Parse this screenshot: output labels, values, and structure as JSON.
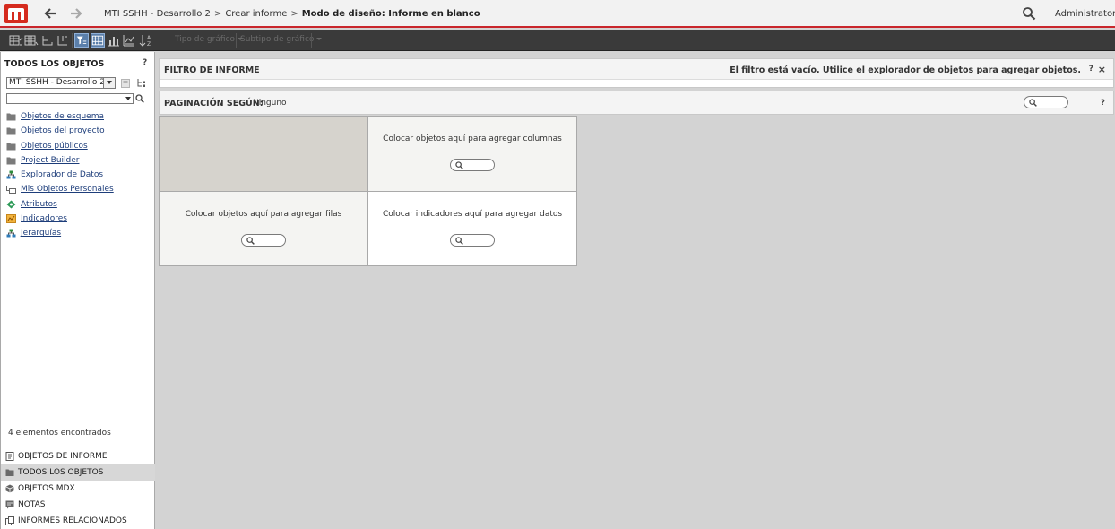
{
  "header": {
    "breadcrumb": [
      {
        "label": "MTI SSHH - Desarrollo 2"
      },
      {
        "label": "Crear informe"
      }
    ],
    "current": "Modo de diseño: Informe en blanco",
    "user": "Administrator"
  },
  "toolbar": {
    "chart_type": "Tipo de gráfico",
    "chart_subtype": "Subtipo de gráfico"
  },
  "left_panel": {
    "title": "TODOS LOS OBJETOS",
    "help": "?",
    "project": "MTI SSHH - Desarrollo 2",
    "tree": [
      {
        "label": "Objetos de esquema",
        "icon": "folder-icon"
      },
      {
        "label": "Objetos del proyecto",
        "icon": "folder-icon"
      },
      {
        "label": "Objetos públicos",
        "icon": "folder-icon"
      },
      {
        "label": "Project Builder",
        "icon": "folder-icon"
      },
      {
        "label": "Explorador de Datos",
        "icon": "hierarchy-icon"
      },
      {
        "label": "Mis Objetos Personales",
        "icon": "personal-objects-icon"
      },
      {
        "label": "Atributos",
        "icon": "attribute-icon"
      },
      {
        "label": "Indicadores",
        "icon": "metrics-icon"
      },
      {
        "label": "Jerarquías",
        "icon": "hierarchy-icon"
      }
    ],
    "found": "4 elementos encontrados",
    "accordion": [
      {
        "label": "OBJETOS DE INFORME",
        "icon": "report-objects-icon"
      },
      {
        "label": "TODOS LOS OBJETOS",
        "icon": "folder-icon"
      },
      {
        "label": "OBJETOS MDX",
        "icon": "cube-icon"
      },
      {
        "label": "NOTAS",
        "icon": "notes-icon"
      },
      {
        "label": "INFORMES RELACIONADOS",
        "icon": "related-reports-icon"
      }
    ]
  },
  "filter": {
    "title": "FILTRO DE INFORME",
    "message": "El filtro está vacío. Utilice el explorador de objetos para agregar objetos.",
    "help": "?",
    "close": "×"
  },
  "paging": {
    "title": "PAGINACIÓN SEGÚN:",
    "value": "Ninguno",
    "help": "?"
  },
  "grid": {
    "columns_hint": "Colocar objetos aquí para agregar columnas",
    "rows_hint": "Colocar objetos aquí para agregar filas",
    "data_hint": "Colocar indicadores aquí para agregar datos"
  }
}
